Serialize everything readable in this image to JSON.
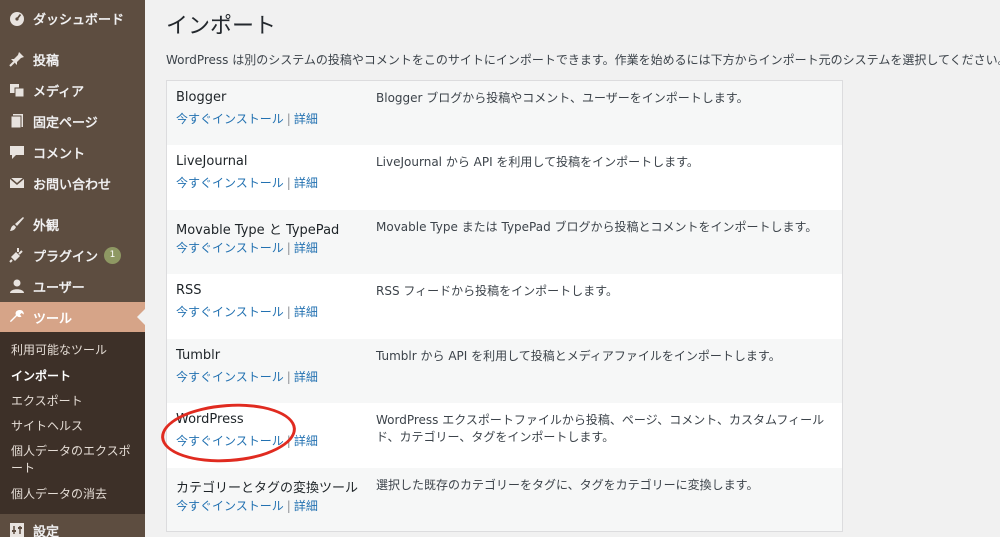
{
  "sidebar": {
    "items": [
      {
        "key": "dashboard",
        "label": "ダッシュボード",
        "icon": "dashboard-icon"
      },
      {
        "key": "posts",
        "label": "投稿",
        "icon": "pin-icon"
      },
      {
        "key": "media",
        "label": "メディア",
        "icon": "media-icon"
      },
      {
        "key": "pages",
        "label": "固定ページ",
        "icon": "page-icon"
      },
      {
        "key": "comments",
        "label": "コメント",
        "icon": "comment-icon"
      },
      {
        "key": "contact",
        "label": "お問い合わせ",
        "icon": "mail-icon"
      },
      {
        "key": "appearance",
        "label": "外観",
        "icon": "brush-icon"
      },
      {
        "key": "plugins",
        "label": "プラグイン",
        "icon": "plugin-icon",
        "badge": "1"
      },
      {
        "key": "users",
        "label": "ユーザー",
        "icon": "user-icon"
      },
      {
        "key": "tools",
        "label": "ツール",
        "icon": "wrench-icon",
        "current": true
      },
      {
        "key": "settings",
        "label": "設定",
        "icon": "settings-icon"
      }
    ],
    "submenu": [
      {
        "label": "利用可能なツール"
      },
      {
        "label": "インポート",
        "current": true
      },
      {
        "label": "エクスポート"
      },
      {
        "label": "サイトヘルス"
      },
      {
        "label": "個人データのエクスポート"
      },
      {
        "label": "個人データの消去"
      }
    ],
    "accent_color": "#d6a488",
    "badge_color": "#8e9863"
  },
  "page": {
    "title": "インポート",
    "intro": "WordPress は別のシステムの投稿やコメントをこのサイトにインポートできます。作業を始めるには下方からインポート元のシステムを選択してください。"
  },
  "importers": [
    {
      "name": "Blogger",
      "install": "今すぐインストール",
      "sep": "|",
      "details": "詳細",
      "description": "Blogger ブログから投稿やコメント、ユーザーをインポートします。"
    },
    {
      "name": "LiveJournal",
      "install": "今すぐインストール",
      "sep": "|",
      "details": "詳細",
      "description": "LiveJournal から API を利用して投稿をインポートします。"
    },
    {
      "name": "Movable Type と TypePad",
      "install": "今すぐインストール",
      "sep": "|",
      "details": "詳細",
      "description": "Movable Type または TypePad ブログから投稿とコメントをインポートします。"
    },
    {
      "name": "RSS",
      "install": "今すぐインストール",
      "sep": "|",
      "details": "詳細",
      "description": "RSS フィードから投稿をインポートします。"
    },
    {
      "name": "Tumblr",
      "install": "今すぐインストール",
      "sep": "|",
      "details": "詳細",
      "description": "Tumblr から API を利用して投稿とメディアファイルをインポートします。"
    },
    {
      "name": "WordPress",
      "install": "今すぐインストール",
      "sep": "|",
      "details": "詳細",
      "description": "WordPress エクスポートファイルから投稿、ページ、コメント、カスタムフィールド、カテゴリー、タグをインポートします。"
    },
    {
      "name": "カテゴリーとタグの変換ツール",
      "install": "今すぐインストール",
      "sep": "|",
      "details": "詳細",
      "description": "選択した既存のカテゴリーをタグに、タグをカテゴリーに変換します。"
    }
  ],
  "annotation": {
    "color": "#e02b20"
  }
}
